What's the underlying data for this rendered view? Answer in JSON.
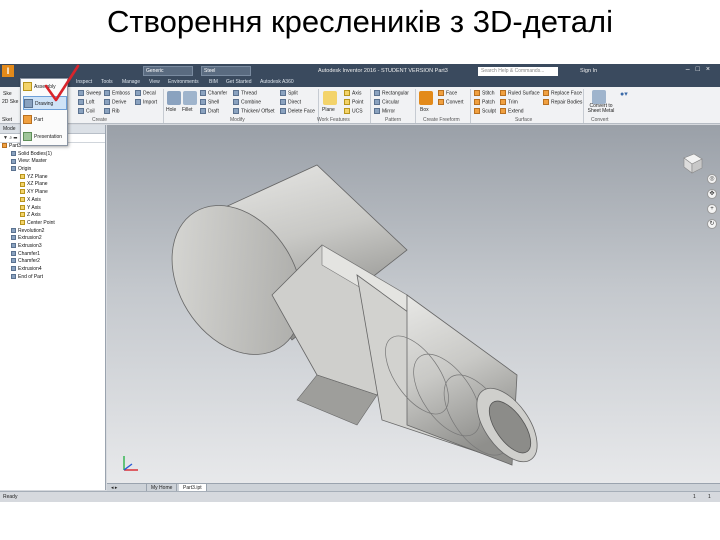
{
  "slide_title": "Створення креслеників з 3D-деталі",
  "app": {
    "logo": "I",
    "quick_access": [
      "Generic",
      "Steel"
    ],
    "window_title": "Autodesk Inventor 2016 - STUDENT VERSION   Part3",
    "search_placeholder": "Search Help & Commands...",
    "sign_in": "Sign In",
    "tabs": [
      "Inspect",
      "Tools",
      "Manage",
      "View",
      "Environments",
      "BIM",
      "Get Started",
      "Autodesk A360"
    ],
    "new_menu": {
      "items": [
        "Assembly",
        "Drawing",
        "Part",
        "Presentation"
      ],
      "selected": "Drawing"
    },
    "ribbon": {
      "sketch_stub": [
        "Ske",
        "2D Ske",
        "Sket"
      ],
      "create_col1": [
        "Sweep",
        "Loft",
        "Coil"
      ],
      "create_col2": [
        "Emboss",
        "Derive",
        "Rib"
      ],
      "create_col3": [
        "Decal",
        "Import"
      ],
      "create_label": "Create",
      "modify_big": [
        "Hole",
        "Fillet"
      ],
      "modify_col1": [
        "Chamfer",
        "Shell",
        "Draft"
      ],
      "modify_col2": [
        "Thread",
        "Combine",
        "Thicken/ Offset"
      ],
      "modify_col3": [
        "Split",
        "Direct",
        "Delete Face"
      ],
      "modify_label": "Modify",
      "work_big": "Plane",
      "work_col": [
        "Axis",
        "Point",
        "UCS"
      ],
      "work_label": "Work Features",
      "pattern_col": [
        "Rectangular",
        "Circular",
        "Mirror"
      ],
      "pattern_label": "Pattern",
      "freeform_big": "Box",
      "freeform_col": [
        "Face",
        "Convert"
      ],
      "freeform_label": "Create Freeform",
      "surface_col1": [
        "Stitch",
        "Patch",
        "Sculpt"
      ],
      "surface_col2": [
        "Ruled Surface",
        "Trim",
        "Extend"
      ],
      "surface_col3": [
        "Replace Face",
        "Repair Bodies"
      ],
      "surface_label": "Surface",
      "convert_big": "Convert to Sheet Metal",
      "convert_label": "Convert"
    },
    "browser": {
      "header": "Mode",
      "tree": [
        {
          "label": "Part3",
          "indent": 0
        },
        {
          "label": "Solid Bodies(1)",
          "indent": 1
        },
        {
          "label": "View: Master",
          "indent": 1
        },
        {
          "label": "Origin",
          "indent": 1
        },
        {
          "label": "YZ Plane",
          "indent": 2
        },
        {
          "label": "XZ Plane",
          "indent": 2
        },
        {
          "label": "XY Plane",
          "indent": 2
        },
        {
          "label": "X Axis",
          "indent": 2
        },
        {
          "label": "Y Axis",
          "indent": 2
        },
        {
          "label": "Z Axis",
          "indent": 2
        },
        {
          "label": "Center Point",
          "indent": 2
        },
        {
          "label": "Revolution2",
          "indent": 1
        },
        {
          "label": "Extrusion2",
          "indent": 1
        },
        {
          "label": "Extrusion3",
          "indent": 1
        },
        {
          "label": "Chamfer1",
          "indent": 1
        },
        {
          "label": "Chamfer2",
          "indent": 1
        },
        {
          "label": "Extrusion4",
          "indent": 1
        },
        {
          "label": "End of Part",
          "indent": 1
        }
      ]
    },
    "doc_tabs": [
      "My Home",
      "Part3.ipt"
    ],
    "status_left": "Ready",
    "status_right": [
      "1",
      "1"
    ]
  },
  "colors": {
    "accent": "#e38a1a",
    "titlebar": "#3a4a5e",
    "checkmark": "#d9242b"
  }
}
